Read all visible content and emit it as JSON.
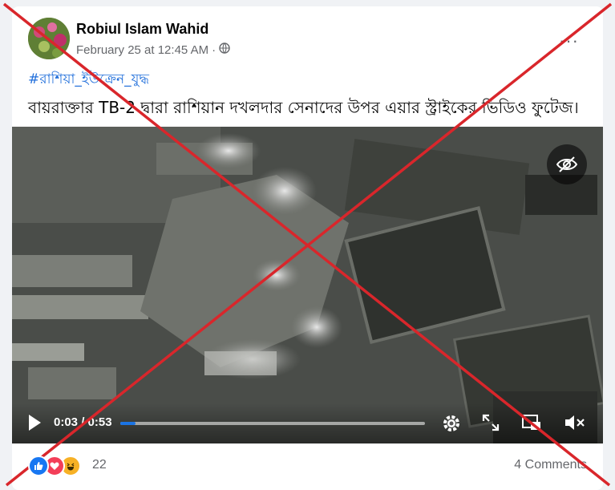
{
  "post": {
    "author": "Robiul Islam Wahid",
    "timestamp": "February 25 at 12:45 AM",
    "separator": "·",
    "privacy_icon": "globe-icon",
    "more_icon": "more-icon",
    "more_label": "···",
    "hashtag": "#রাশিয়া_ইউক্রেন_যুদ্ধ",
    "caption": "বায়রাক্তার TB-2 দ্বারা রাশিয়ান দখলদার সেনাদের উপর এয়ার স্ট্রাইকের ভিডিও ফুটেজ।"
  },
  "video": {
    "current_time": "0:03",
    "time_separator": "/",
    "duration": "0:53",
    "progress_fraction": 0.05,
    "hide_icon": "eye-slash-icon",
    "controls": [
      "play-icon",
      "settings-icon",
      "fullscreen-icon",
      "picture-in-picture-icon",
      "volume-mute-icon"
    ]
  },
  "footer": {
    "reaction_icons": [
      "like-icon",
      "love-icon",
      "haha-icon"
    ],
    "reaction_count": "22",
    "comments": "4 Comments"
  },
  "colors": {
    "link": "#216fdb",
    "progress": "#1b74e4",
    "cross": "#d9262b"
  }
}
